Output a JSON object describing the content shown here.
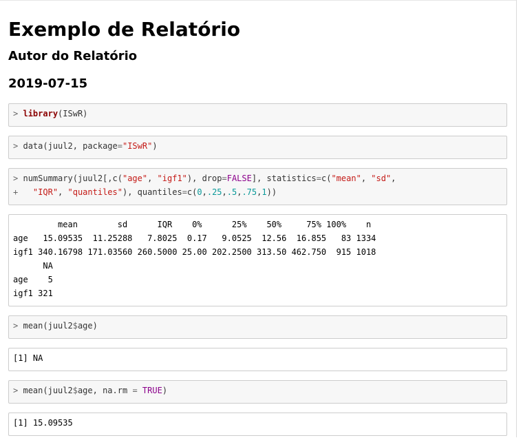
{
  "document": {
    "title": "Exemplo de Relatório",
    "author": "Autor do Relatório",
    "date": "2019-07-15"
  },
  "chunks": {
    "c1": {
      "prompt": ">",
      "fn": "library",
      "args": "(ISwR)"
    },
    "c2": {
      "prompt": ">",
      "p1": "data(juul2, package",
      "eq": "=",
      "str": "\"ISwR\"",
      "close": ")"
    },
    "c3": {
      "prompt": ">",
      "cont_prompt": "+",
      "l1_a": "numSummary(juul2[,c(",
      "l1_age": "\"age\"",
      "l1_b": ", ",
      "l1_igf1": "\"igf1\"",
      "l1_c": "), drop",
      "l1_eq1": "=",
      "l1_false": "FALSE",
      "l1_d": "], statistics",
      "l1_eq2": "=",
      "l1_e": "c(",
      "l1_mean": "\"mean\"",
      "l1_f": ", ",
      "l1_sd": "\"sd\"",
      "l1_g": ",",
      "l2_iqr": "\"IQR\"",
      "l2_a": ", ",
      "l2_quant": "\"quantiles\"",
      "l2_b": "), quantiles",
      "l2_eq": "=",
      "l2_c": "c(",
      "l2_n0": "0",
      "l2_s1": ",",
      "l2_n1": ".25",
      "l2_s2": ",",
      "l2_n2": ".5",
      "l2_s3": ",",
      "l2_n3": ".75",
      "l2_s4": ",",
      "l2_n4": "1",
      "l2_end": "))"
    },
    "o3": {
      "lines": [
        "         mean        sd      IQR    0%      25%    50%     75% 100%    n",
        "age   15.09535  11.25288   7.8025  0.17   9.0525  12.56  16.855   83 1334",
        "igf1 340.16798 171.03560 260.5000 25.00 202.2500 313.50 462.750  915 1018",
        "      NA",
        "age    5",
        "igf1 321"
      ]
    },
    "c4": {
      "prompt": ">",
      "a": "mean(juul2",
      "dollar": "$",
      "b": "age)"
    },
    "o4": {
      "text": "[1] NA"
    },
    "c5": {
      "prompt": ">",
      "a": "mean(juul2",
      "dollar": "$",
      "b": "age, na.rm ",
      "eq": "=",
      "sp": " ",
      "true": "TRUE",
      "close": ")"
    },
    "o5": {
      "text": "[1] 15.09535"
    }
  },
  "colors": {
    "code_background": "#f7f7f7",
    "border": "#cccccc",
    "keyword": "#8b0000",
    "string": "#c41a16",
    "number": "#099999",
    "constant": "#8b008b"
  }
}
